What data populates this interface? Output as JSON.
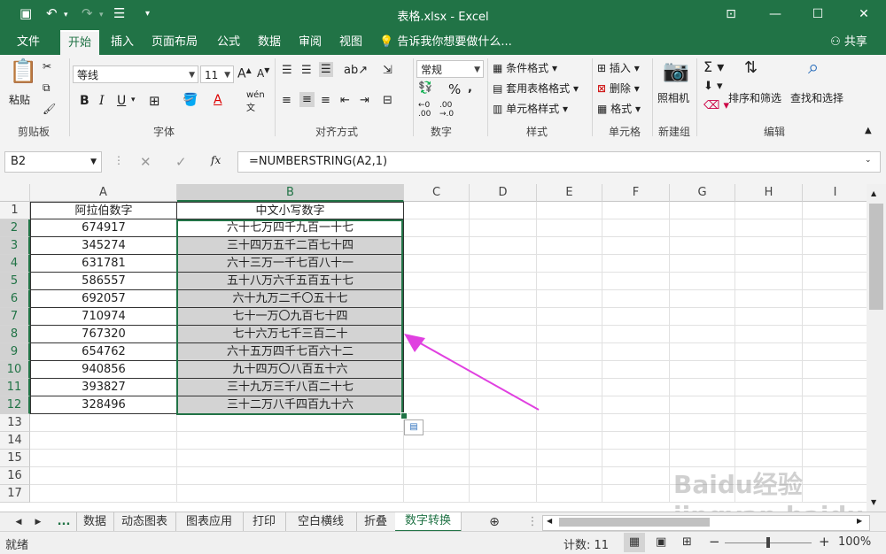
{
  "window": {
    "title": "表格.xlsx - Excel"
  },
  "ribbon_tabs": [
    "文件",
    "开始",
    "插入",
    "页面布局",
    "公式",
    "数据",
    "审阅",
    "视图"
  ],
  "active_tab": "开始",
  "tell_me": "告诉我你想要做什么...",
  "share": "共享",
  "ribbon": {
    "clipboard": {
      "paste": "粘贴",
      "label": "剪贴板"
    },
    "font": {
      "name": "等线",
      "size": "11",
      "label": "字体"
    },
    "alignment": {
      "label": "对齐方式"
    },
    "number": {
      "format": "常规",
      "label": "数字"
    },
    "styles": {
      "conditional": "条件格式",
      "table": "套用表格格式",
      "cell": "单元格样式",
      "label": "样式"
    },
    "cells": {
      "insert": "插入",
      "delete": "删除",
      "format": "格式",
      "label": "单元格"
    },
    "camera": {
      "name": "照相机",
      "label": "新建组"
    },
    "editing": {
      "sort": "排序和筛选",
      "find": "查找和选择",
      "label": "编辑"
    }
  },
  "formula_bar": {
    "name_box": "B2",
    "formula": "=NUMBERSTRING(A2,1)"
  },
  "columns": [
    "A",
    "B",
    "C",
    "D",
    "E",
    "F",
    "G",
    "H",
    "I"
  ],
  "rows": [
    "1",
    "2",
    "3",
    "4",
    "5",
    "6",
    "7",
    "8",
    "9",
    "10",
    "11",
    "12",
    "13",
    "14",
    "15",
    "16",
    "17"
  ],
  "table": {
    "headers": [
      "阿拉伯数字",
      "中文小写数字"
    ],
    "data": [
      [
        "674917",
        "六十七万四千九百一十七"
      ],
      [
        "345274",
        "三十四万五千二百七十四"
      ],
      [
        "631781",
        "六十三万一千七百八十一"
      ],
      [
        "586557",
        "五十八万六千五百五十七"
      ],
      [
        "692057",
        "六十九万二千〇五十七"
      ],
      [
        "710974",
        "七十一万〇九百七十四"
      ],
      [
        "767320",
        "七十六万七千三百二十"
      ],
      [
        "654762",
        "六十五万四千七百六十二"
      ],
      [
        "940856",
        "九十四万〇八百五十六"
      ],
      [
        "393827",
        "三十九万三千八百二十七"
      ],
      [
        "328496",
        "三十二万八千四百九十六"
      ]
    ]
  },
  "sheet_tabs": [
    "...",
    "数据",
    "动态图表",
    "图表应用",
    "打印",
    "空白横线",
    "折叠",
    "数字转换"
  ],
  "active_sheet": "数字转换",
  "status": {
    "ready": "就绪",
    "count": "计数: 11",
    "zoom": "100%"
  },
  "watermark": "Baidu经验 jingyan.baidu.com",
  "colors": {
    "excel_green": "#217346",
    "arrow": "#e040e0",
    "selection": "#d3d3d3"
  }
}
